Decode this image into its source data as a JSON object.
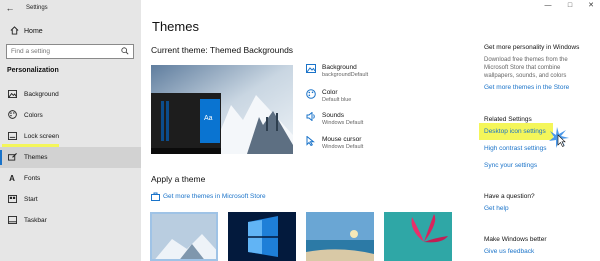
{
  "window": {
    "title": "Settings",
    "back_icon": "back-arrow-icon",
    "controls": [
      "minimize-icon",
      "maximize-icon",
      "close-icon"
    ]
  },
  "sidebar": {
    "home_label": "Home",
    "search_placeholder": "Find a setting",
    "section_title": "Personalization",
    "items": [
      {
        "label": "Background",
        "icon": "image-icon",
        "active": false
      },
      {
        "label": "Colors",
        "icon": "palette-icon",
        "active": false
      },
      {
        "label": "Lock screen",
        "icon": "lock-screen-icon",
        "active": false
      },
      {
        "label": "Themes",
        "icon": "brush-icon",
        "active": true
      },
      {
        "label": "Fonts",
        "icon": "fonts-icon",
        "active": false
      },
      {
        "label": "Start",
        "icon": "start-icon",
        "active": false
      },
      {
        "label": "Taskbar",
        "icon": "taskbar-icon",
        "active": false
      }
    ]
  },
  "main": {
    "title": "Themes",
    "current_theme": "Current theme: Themed Backgrounds",
    "preview_tile": "Aa",
    "properties": [
      {
        "label": "Background",
        "value": "backgroundDefault",
        "icon": "image-icon"
      },
      {
        "label": "Color",
        "value": "Default blue",
        "icon": "palette-icon"
      },
      {
        "label": "Sounds",
        "value": "Windows Default",
        "icon": "speaker-icon"
      },
      {
        "label": "Mouse cursor",
        "value": "Windows Default",
        "icon": "cursor-icon"
      }
    ],
    "apply_title": "Apply a theme",
    "store_link": "Get more themes in Microsoft Store"
  },
  "right": {
    "personality_heading": "Get more personality in Windows",
    "personality_text": [
      "Download free themes from the",
      "Microsoft Store that combine",
      "wallpapers, sounds, and colors"
    ],
    "store_link": "Get more themes in the Store",
    "related_heading": "Related Settings",
    "related_links": [
      "Desktop icon settings",
      "High contrast settings",
      "Sync your settings"
    ],
    "question_heading": "Have a question?",
    "help_link": "Get help",
    "better_heading": "Make Windows better",
    "feedback_link": "Give us feedback"
  },
  "colors": {
    "accent": "#1a73c9",
    "highlight": "#f4f65a",
    "sidebar_bg": "#e6e6e6"
  }
}
